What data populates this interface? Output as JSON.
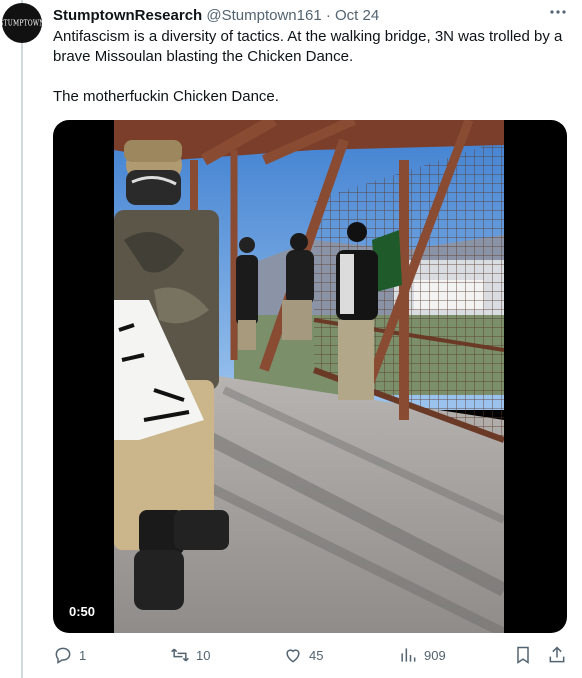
{
  "author": {
    "display_name": "StumptownResearch",
    "handle": "@Stumptown161",
    "separator": "·",
    "date": "Oct 24",
    "avatar_text": "STUMPTOWN"
  },
  "tweet": {
    "paragraphs": [
      "Antifascism is a diversity of tactics. At the walking bridge, 3N was trolled by a brave Missoulan blasting the Chicken Dance.",
      "The motherfuckin Chicken Dance."
    ]
  },
  "media": {
    "duration": "0:50"
  },
  "actions": {
    "replies": "1",
    "reposts": "10",
    "likes": "45",
    "views": "909"
  },
  "icons": {
    "more": "more-horizontal-icon",
    "reply": "reply-icon",
    "repost": "repost-icon",
    "like": "heart-icon",
    "views": "views-chart-icon",
    "bookmark": "bookmark-icon",
    "share": "share-icon"
  },
  "colors": {
    "text": "#0f1419",
    "muted": "#536471",
    "thread_line": "#cfd9de",
    "sky": "#5d95d6",
    "bridge_rust": "#8a4b33"
  }
}
